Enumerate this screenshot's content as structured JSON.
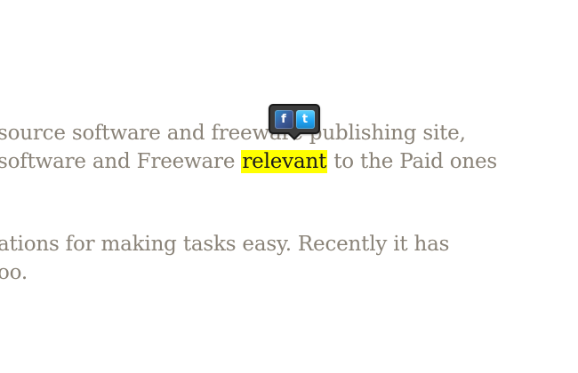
{
  "article": {
    "line1": "source software and freeware publishing site,",
    "line2_before": "software and Freeware ",
    "line2_highlight": "relevant",
    "line2_after": " to the Paid ones",
    "line3": "ations for making tasks easy. Recently it has",
    "line4": "oo."
  },
  "share_popover": {
    "facebook_glyph": "f",
    "twitter_glyph": "t",
    "facebook_icon": "facebook-icon",
    "twitter_icon": "twitter-icon"
  },
  "colors": {
    "text": "#8a8378",
    "highlight": "#ffff00",
    "popover_bg": "#3c3c3c"
  }
}
